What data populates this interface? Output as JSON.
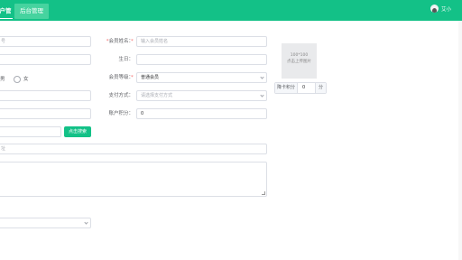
{
  "header": {
    "active_tab": "客户管理",
    "tab_back": "后台管理",
    "user_name": "艾小"
  },
  "form": {
    "left": {
      "row1_placeholder": "号",
      "gender_left_label": "男",
      "gender_right_label": "女",
      "search_button": "点击搜索",
      "remark_placeholder": "址"
    },
    "right": {
      "member_name_label": "会员姓名：",
      "member_name_placeholder": "输入会员姓名",
      "birthday_label": "生日：",
      "member_level_label": "会员等级：",
      "member_level_value": "普通会员",
      "payment_label": "支付方式：",
      "payment_placeholder": "请选择支付方式",
      "points_label": "账户积分：",
      "points_value": "0"
    },
    "upload": {
      "size_text": "100*100",
      "hint": "点击上传图片"
    },
    "deduct": {
      "label": "降卡积分",
      "value": "0",
      "unit": "分"
    },
    "required_mark": "*"
  }
}
